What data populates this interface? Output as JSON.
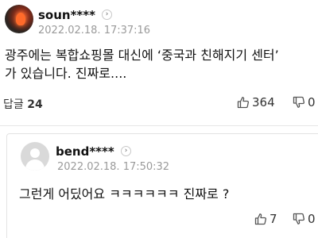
{
  "comment": {
    "username": "soun****",
    "timestamp": "2022.02.18. 17:37:16",
    "text_line1": "광주에는 복합쇼핑몰 대신에 ‘중국과 친해지기 센터’",
    "text_line2": "가 있습니다. 진짜로....",
    "reply_label": "답글",
    "reply_count": "24",
    "like_count": "364",
    "dislike_count": "0"
  },
  "reply": {
    "username": "bend****",
    "timestamp": "2022.02.18. 17:50:32",
    "text": "그런게 어딨어요 ㅋㅋㅋㅋㅋㅋ 진짜로 ?",
    "like_count": "7",
    "dislike_count": "0"
  },
  "icons": {
    "profile_chevron": "chevron-right-icon",
    "like": "thumbs-up-icon",
    "dislike": "thumbs-down-icon"
  }
}
